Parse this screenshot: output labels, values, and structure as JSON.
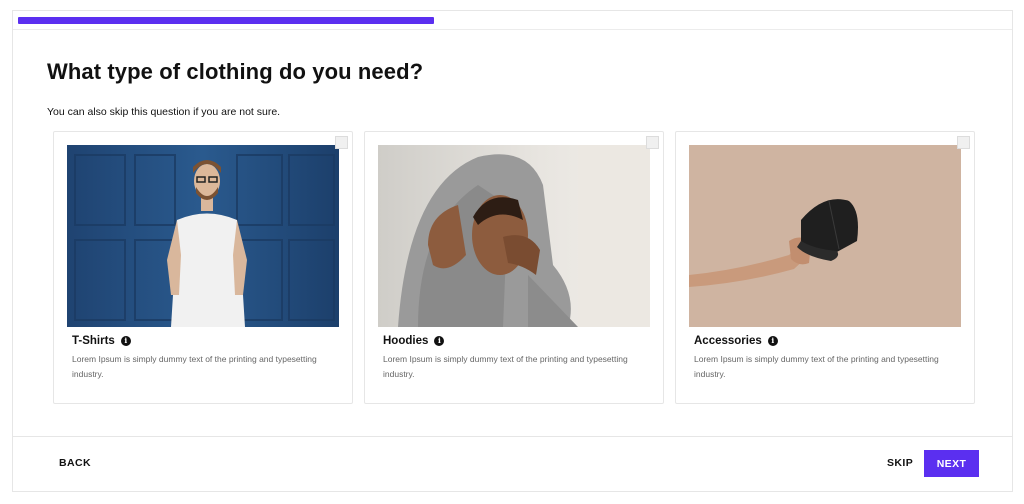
{
  "progress": {
    "fraction": 0.42,
    "color": "#5b2ff0"
  },
  "question": {
    "title": "What type of clothing do you need?",
    "subtitle": "You can also skip this question if you are not sure."
  },
  "options": [
    {
      "title": "T-Shirts",
      "description": "Lorem Ipsum is simply dummy text of the printing and typesetting industry.",
      "image": "man-in-white-tshirt-photo",
      "checked": false
    },
    {
      "title": "Hoodies",
      "description": "Lorem Ipsum is simply dummy text of the printing and typesetting industry.",
      "image": "man-in-grey-hoodie-photo",
      "checked": false
    },
    {
      "title": "Accessories",
      "description": "Lorem Ipsum is simply dummy text of the printing and typesetting industry.",
      "image": "hand-holding-black-cap-photo",
      "checked": false
    }
  ],
  "icons": {
    "info": "info-icon"
  },
  "footer": {
    "back_label": "BACK",
    "skip_label": "SKIP",
    "next_label": "NEXT"
  }
}
